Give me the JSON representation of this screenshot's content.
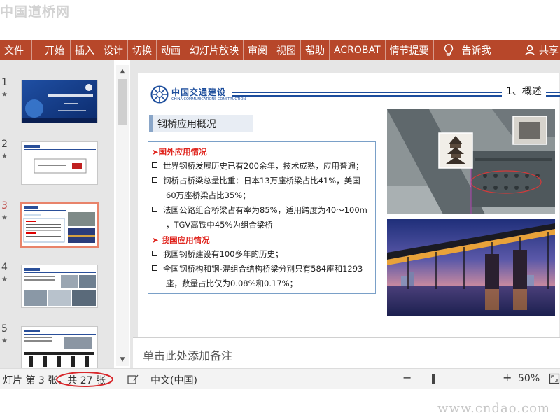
{
  "watermarks": {
    "top": "中国道桥网",
    "bottom": "www.cndao.com"
  },
  "ribbon": {
    "tabs": [
      "文件",
      "开始",
      "插入",
      "设计",
      "切换",
      "动画",
      "幻灯片放映",
      "审阅",
      "视图",
      "帮助",
      "ACROBAT",
      "情节提要"
    ],
    "tell_me": "告诉我",
    "share": "共享",
    "color": "#b7472a"
  },
  "thumbnails": [
    {
      "number": "1"
    },
    {
      "number": "2"
    },
    {
      "number": "3"
    },
    {
      "number": "4"
    },
    {
      "number": "5"
    }
  ],
  "slide": {
    "logo_cn": "中国交通建设",
    "logo_en": "CHINA COMMUNICATIONS CONSTRUCTION",
    "section": "1、概述",
    "title": "钢桥应用概况",
    "foreign_heading": "➤国外应用情况",
    "foreign_bullets": [
      "世界钢桥发展历史已有200余年，技术成熟，应用普遍；",
      "钢桥占桥梁总量比重：日本13万座桥梁占比41%，美国",
      "60万座桥梁占比35%；",
      "法国公路组合桥梁占有率为85%，适用跨度为40～100m",
      "，TGV高铁中45%为组合梁桥"
    ],
    "china_heading": "➤  我国应用情况",
    "china_bullets": [
      "我国钢桥建设有100多年的历史；",
      "全国钢桥构和钢-混组合结构桥梁分别只有584座和1293",
      "座，数量占比仅为0.08%和0.17%；"
    ]
  },
  "notes_placeholder": "单击此处添加备注",
  "status": {
    "slide_info": "灯片 第 3 张，共 27 张",
    "language": "中文(中国)",
    "zoom": "50%",
    "zoom_level": 50
  }
}
